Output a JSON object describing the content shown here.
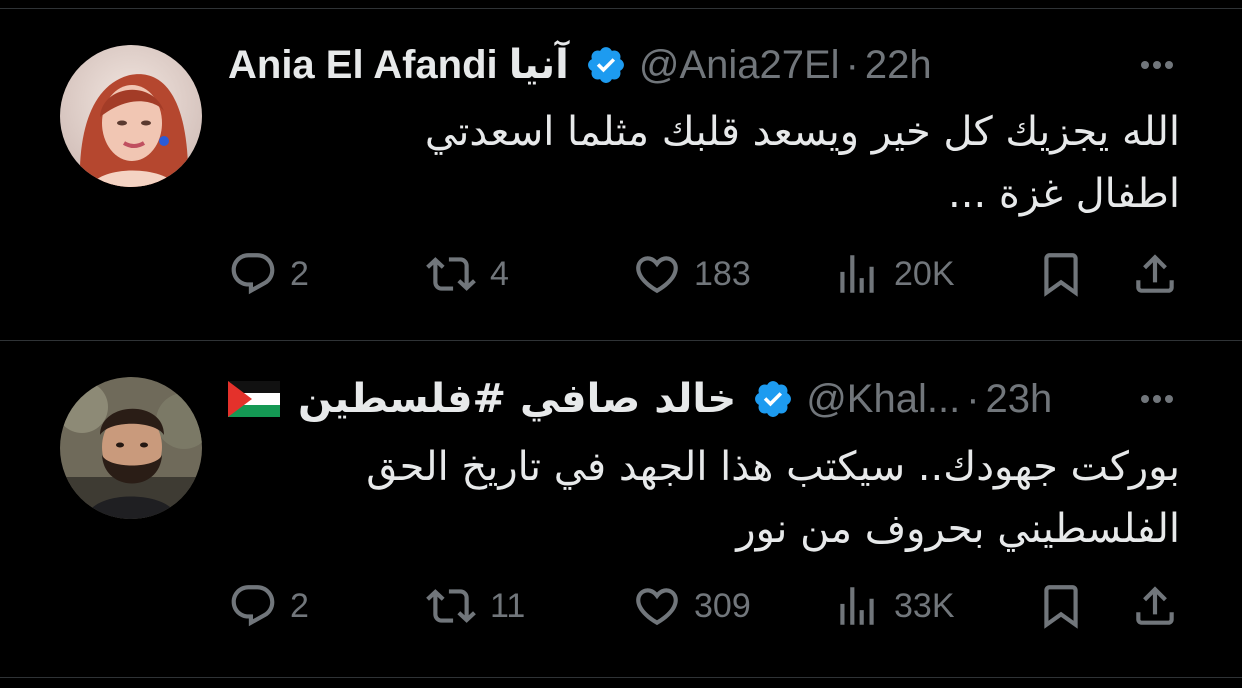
{
  "tweets": [
    {
      "name": "Ania El Afandi آنيا",
      "handle": "@Ania27El",
      "time": "22h",
      "text_line1": "الله يجزيك كل خير ويسعد قلبك مثلما اسعدتي",
      "text_line2": "اطفال غزة ...",
      "replies": "2",
      "retweets": "4",
      "likes": "183",
      "views": "20K"
    },
    {
      "name": "خالد صافي #فلسطين",
      "handle": "@Khal...",
      "time": "23h",
      "text_line1": "بوركت جهودك.. سيكتب هذا الجهد في تاريخ الحق",
      "text_line2": "الفلسطيني بحروف من نور",
      "replies": "2",
      "retweets": "11",
      "likes": "309",
      "views": "33K"
    }
  ],
  "separator": "·",
  "colors": {
    "background": "#000000",
    "text": "#e7e9ea",
    "muted": "#71767b",
    "verified": "#1d9bf0",
    "divider": "#2f3336"
  },
  "icons": [
    "verified-badge-icon",
    "more-icon",
    "reply-icon",
    "retweet-icon",
    "like-icon",
    "views-icon",
    "bookmark-icon",
    "share-icon",
    "palestine-flag-icon"
  ]
}
